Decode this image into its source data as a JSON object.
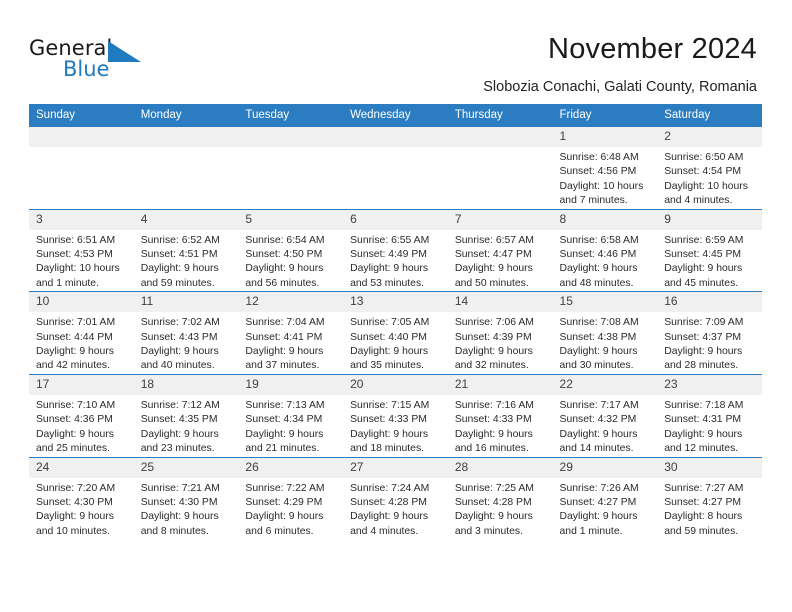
{
  "brand": {
    "word_one": "General",
    "word_two": "Blue",
    "mark_color": "#1f7ac0"
  },
  "header": {
    "title": "November 2024",
    "location": "Slobozia Conachi, Galati County, Romania"
  },
  "theme": {
    "header_blue": "#2b7cc0",
    "daynum_bg": "#f0f0f0",
    "text": "#2b2b2b"
  },
  "weekday_headers": [
    "Sunday",
    "Monday",
    "Tuesday",
    "Wednesday",
    "Thursday",
    "Friday",
    "Saturday"
  ],
  "labels": {
    "sunrise_prefix": "Sunrise:",
    "sunset_prefix": "Sunset:",
    "daylight_prefix": "Daylight:"
  },
  "weeks": [
    [
      {
        "day": "",
        "blank": true
      },
      {
        "day": "",
        "blank": true
      },
      {
        "day": "",
        "blank": true
      },
      {
        "day": "",
        "blank": true
      },
      {
        "day": "",
        "blank": true
      },
      {
        "day": "1",
        "sunrise": "Sunrise: 6:48 AM",
        "sunset": "Sunset: 4:56 PM",
        "daylight": "Daylight: 10 hours and 7 minutes."
      },
      {
        "day": "2",
        "sunrise": "Sunrise: 6:50 AM",
        "sunset": "Sunset: 4:54 PM",
        "daylight": "Daylight: 10 hours and 4 minutes."
      }
    ],
    [
      {
        "day": "3",
        "sunrise": "Sunrise: 6:51 AM",
        "sunset": "Sunset: 4:53 PM",
        "daylight": "Daylight: 10 hours and 1 minute."
      },
      {
        "day": "4",
        "sunrise": "Sunrise: 6:52 AM",
        "sunset": "Sunset: 4:51 PM",
        "daylight": "Daylight: 9 hours and 59 minutes."
      },
      {
        "day": "5",
        "sunrise": "Sunrise: 6:54 AM",
        "sunset": "Sunset: 4:50 PM",
        "daylight": "Daylight: 9 hours and 56 minutes."
      },
      {
        "day": "6",
        "sunrise": "Sunrise: 6:55 AM",
        "sunset": "Sunset: 4:49 PM",
        "daylight": "Daylight: 9 hours and 53 minutes."
      },
      {
        "day": "7",
        "sunrise": "Sunrise: 6:57 AM",
        "sunset": "Sunset: 4:47 PM",
        "daylight": "Daylight: 9 hours and 50 minutes."
      },
      {
        "day": "8",
        "sunrise": "Sunrise: 6:58 AM",
        "sunset": "Sunset: 4:46 PM",
        "daylight": "Daylight: 9 hours and 48 minutes."
      },
      {
        "day": "9",
        "sunrise": "Sunrise: 6:59 AM",
        "sunset": "Sunset: 4:45 PM",
        "daylight": "Daylight: 9 hours and 45 minutes."
      }
    ],
    [
      {
        "day": "10",
        "sunrise": "Sunrise: 7:01 AM",
        "sunset": "Sunset: 4:44 PM",
        "daylight": "Daylight: 9 hours and 42 minutes."
      },
      {
        "day": "11",
        "sunrise": "Sunrise: 7:02 AM",
        "sunset": "Sunset: 4:43 PM",
        "daylight": "Daylight: 9 hours and 40 minutes."
      },
      {
        "day": "12",
        "sunrise": "Sunrise: 7:04 AM",
        "sunset": "Sunset: 4:41 PM",
        "daylight": "Daylight: 9 hours and 37 minutes."
      },
      {
        "day": "13",
        "sunrise": "Sunrise: 7:05 AM",
        "sunset": "Sunset: 4:40 PM",
        "daylight": "Daylight: 9 hours and 35 minutes."
      },
      {
        "day": "14",
        "sunrise": "Sunrise: 7:06 AM",
        "sunset": "Sunset: 4:39 PM",
        "daylight": "Daylight: 9 hours and 32 minutes."
      },
      {
        "day": "15",
        "sunrise": "Sunrise: 7:08 AM",
        "sunset": "Sunset: 4:38 PM",
        "daylight": "Daylight: 9 hours and 30 minutes."
      },
      {
        "day": "16",
        "sunrise": "Sunrise: 7:09 AM",
        "sunset": "Sunset: 4:37 PM",
        "daylight": "Daylight: 9 hours and 28 minutes."
      }
    ],
    [
      {
        "day": "17",
        "sunrise": "Sunrise: 7:10 AM",
        "sunset": "Sunset: 4:36 PM",
        "daylight": "Daylight: 9 hours and 25 minutes."
      },
      {
        "day": "18",
        "sunrise": "Sunrise: 7:12 AM",
        "sunset": "Sunset: 4:35 PM",
        "daylight": "Daylight: 9 hours and 23 minutes."
      },
      {
        "day": "19",
        "sunrise": "Sunrise: 7:13 AM",
        "sunset": "Sunset: 4:34 PM",
        "daylight": "Daylight: 9 hours and 21 minutes."
      },
      {
        "day": "20",
        "sunrise": "Sunrise: 7:15 AM",
        "sunset": "Sunset: 4:33 PM",
        "daylight": "Daylight: 9 hours and 18 minutes."
      },
      {
        "day": "21",
        "sunrise": "Sunrise: 7:16 AM",
        "sunset": "Sunset: 4:33 PM",
        "daylight": "Daylight: 9 hours and 16 minutes."
      },
      {
        "day": "22",
        "sunrise": "Sunrise: 7:17 AM",
        "sunset": "Sunset: 4:32 PM",
        "daylight": "Daylight: 9 hours and 14 minutes."
      },
      {
        "day": "23",
        "sunrise": "Sunrise: 7:18 AM",
        "sunset": "Sunset: 4:31 PM",
        "daylight": "Daylight: 9 hours and 12 minutes."
      }
    ],
    [
      {
        "day": "24",
        "sunrise": "Sunrise: 7:20 AM",
        "sunset": "Sunset: 4:30 PM",
        "daylight": "Daylight: 9 hours and 10 minutes."
      },
      {
        "day": "25",
        "sunrise": "Sunrise: 7:21 AM",
        "sunset": "Sunset: 4:30 PM",
        "daylight": "Daylight: 9 hours and 8 minutes."
      },
      {
        "day": "26",
        "sunrise": "Sunrise: 7:22 AM",
        "sunset": "Sunset: 4:29 PM",
        "daylight": "Daylight: 9 hours and 6 minutes."
      },
      {
        "day": "27",
        "sunrise": "Sunrise: 7:24 AM",
        "sunset": "Sunset: 4:28 PM",
        "daylight": "Daylight: 9 hours and 4 minutes."
      },
      {
        "day": "28",
        "sunrise": "Sunrise: 7:25 AM",
        "sunset": "Sunset: 4:28 PM",
        "daylight": "Daylight: 9 hours and 3 minutes."
      },
      {
        "day": "29",
        "sunrise": "Sunrise: 7:26 AM",
        "sunset": "Sunset: 4:27 PM",
        "daylight": "Daylight: 9 hours and 1 minute."
      },
      {
        "day": "30",
        "sunrise": "Sunrise: 7:27 AM",
        "sunset": "Sunset: 4:27 PM",
        "daylight": "Daylight: 8 hours and 59 minutes."
      }
    ]
  ]
}
